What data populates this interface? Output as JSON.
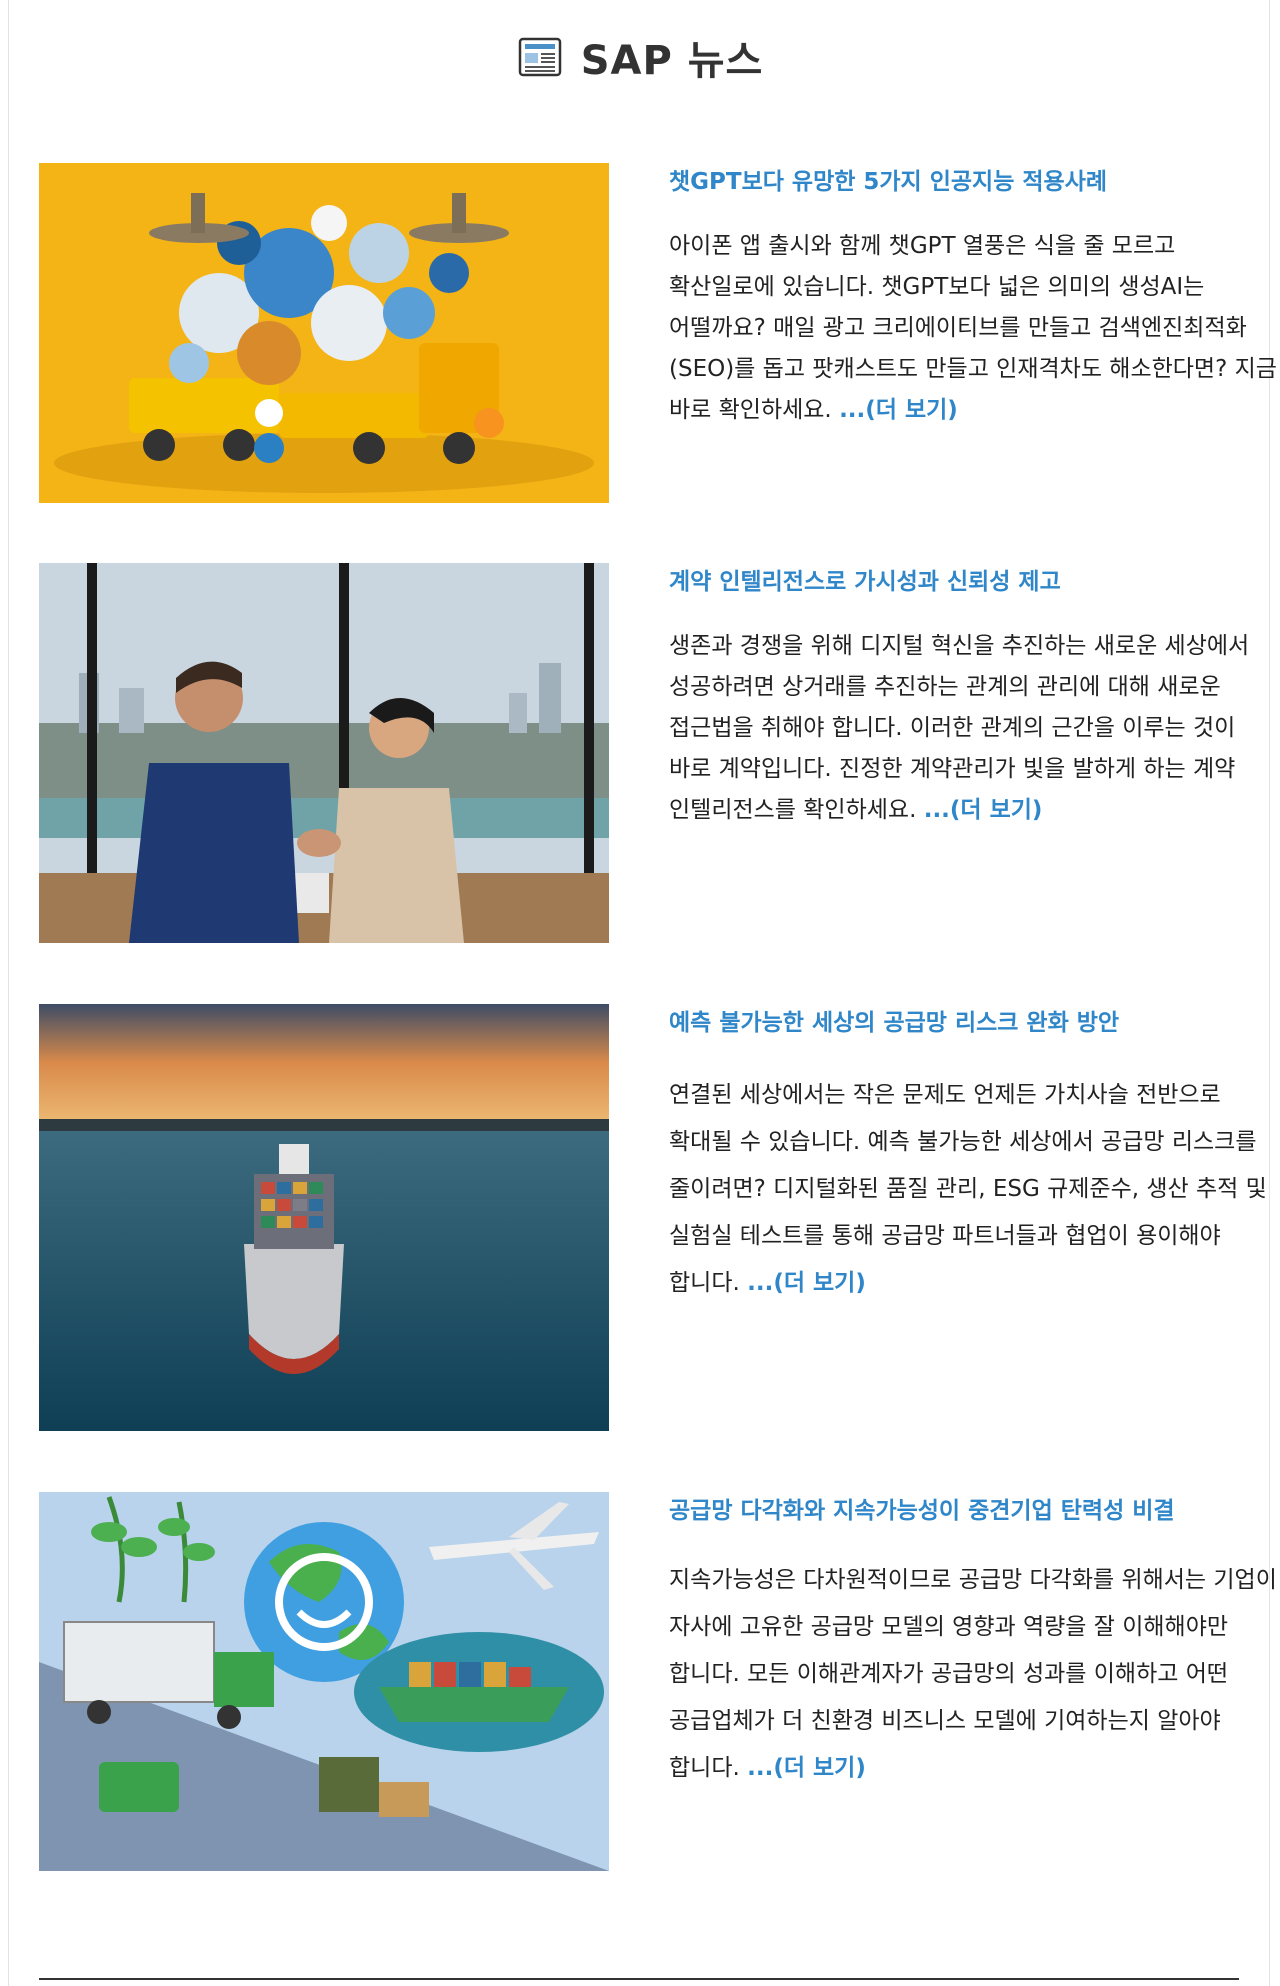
{
  "header": {
    "title": "SAP 뉴스"
  },
  "articles": [
    {
      "title": "챗GPT보다 유망한 5가지 인공지능 적용사례",
      "body": "아이폰 앱 출시와 함께 챗GPT 열풍은 식을 줄 모르고 확산일로에 있습니다. 챗GPT보다 넓은 의미의 생성AI는 어떨까요? 매일 광고 크리에이티브를 만들고 검색엔진최적화(SEO)를 돕고 팟캐스트도 만들고 인재격차도 해소한다면? 지금 바로 확인하세요.",
      "more": "...(더 보기)"
    },
    {
      "title": "계약 인텔리전스로 가시성과 신뢰성 제고",
      "body": "생존과 경쟁을 위해 디지털 혁신을 추진하는 새로운 세상에서 성공하려면 상거래를 추진하는 관계의 관리에 대해 새로운 접근법을 취해야 합니다. 이러한 관계의 근간을 이루는 것이 바로 계약입니다. 진정한 계약관리가 빛을 발하게 하는 계약 인텔리전스를 확인하세요.",
      "more": "...(더 보기)"
    },
    {
      "title": "예측 불가능한 세상의 공급망 리스크 완화 방안",
      "body": "연결된 세상에서는 작은 문제도 언제든 가치사슬 전반으로 확대될 수 있습니다. 예측 불가능한 세상에서 공급망 리스크를 줄이려면? 디지털화된 품질 관리, ESG 규제준수, 생산 추적 및 실험실 테스트를 통해 공급망 파트너들과 협업이 용이해야 합니다.",
      "more": "...(더 보기)"
    },
    {
      "title": "공급망 다각화와 지속가능성이 중견기업 탄력성 비결",
      "body": "지속가능성은 다차원적이므로 공급망 다각화를 위해서는 기업이 자사에 고유한 공급망 모델의 영향과 역량을 잘 이해해야만 합니다. 모든 이해관계자가 공급망의 성과를 이해하고 어떤 공급업체가 더 친환경 비즈니스 모델에 기여하는지 알아야 합니다.",
      "more": "...(더 보기)"
    }
  ],
  "colors": {
    "link": "#2f86c9",
    "text": "#222222",
    "heading": "#333333"
  },
  "icons": {
    "header": "newspaper-icon"
  }
}
